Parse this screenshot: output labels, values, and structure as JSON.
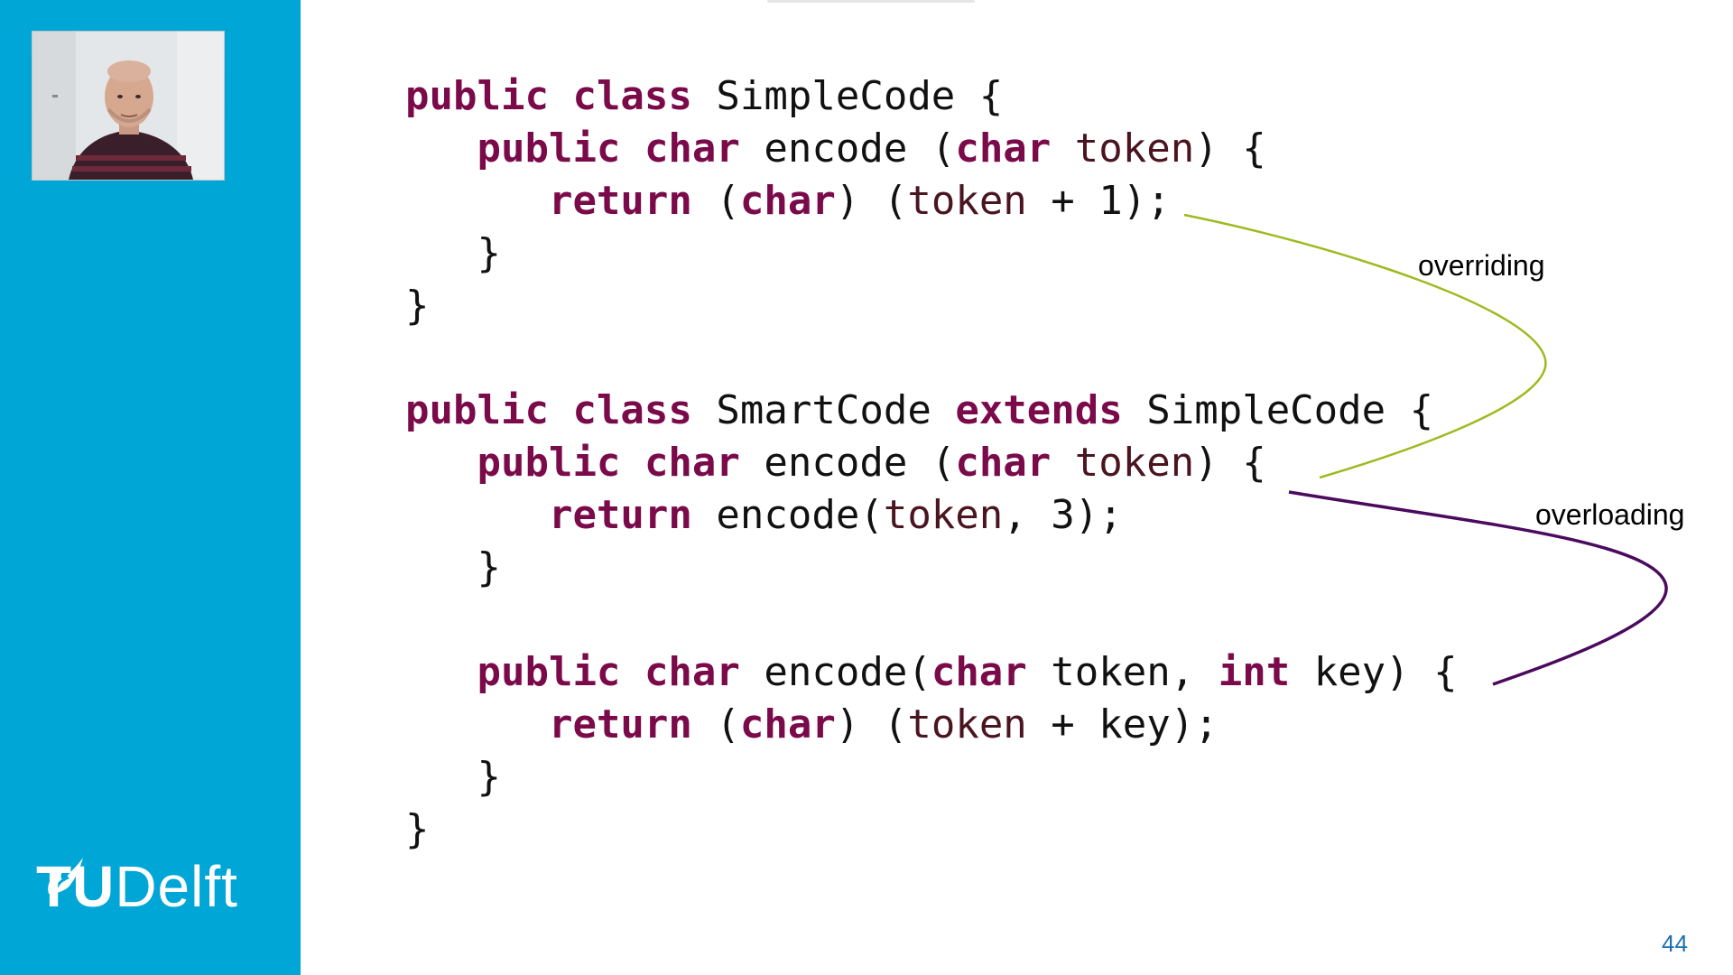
{
  "colors": {
    "sidebar": "#00A6D6",
    "keyword": "#7A0A4A",
    "overriding_arrow": "#9cbb1f",
    "overloading_arrow": "#4b0a5e",
    "slide_number": "#1a6fb0"
  },
  "logo": {
    "tu": "TU",
    "delft": "Delft"
  },
  "webcam": {
    "icon": "presenter-video"
  },
  "code": {
    "lines": [
      [
        {
          "k": "kw",
          "t": "public"
        },
        {
          "k": "pl",
          "t": " "
        },
        {
          "k": "kw",
          "t": "class"
        },
        {
          "k": "pl",
          "t": " SimpleCode {"
        }
      ],
      [
        {
          "k": "pl",
          "t": "   "
        },
        {
          "k": "kw",
          "t": "public"
        },
        {
          "k": "pl",
          "t": " "
        },
        {
          "k": "kw",
          "t": "char"
        },
        {
          "k": "pl",
          "t": " encode ("
        },
        {
          "k": "kw",
          "t": "char"
        },
        {
          "k": "pl",
          "t": " "
        },
        {
          "k": "id",
          "t": "token"
        },
        {
          "k": "pl",
          "t": ") {"
        }
      ],
      [
        {
          "k": "pl",
          "t": "      "
        },
        {
          "k": "kw",
          "t": "return"
        },
        {
          "k": "pl",
          "t": " ("
        },
        {
          "k": "kw",
          "t": "char"
        },
        {
          "k": "pl",
          "t": ") ("
        },
        {
          "k": "id",
          "t": "token"
        },
        {
          "k": "pl",
          "t": " + 1);"
        }
      ],
      [
        {
          "k": "pl",
          "t": "   }"
        }
      ],
      [
        {
          "k": "pl",
          "t": "}"
        }
      ],
      [
        {
          "k": "pl",
          "t": ""
        }
      ],
      [
        {
          "k": "kw",
          "t": "public"
        },
        {
          "k": "pl",
          "t": " "
        },
        {
          "k": "kw",
          "t": "class"
        },
        {
          "k": "pl",
          "t": " SmartCode "
        },
        {
          "k": "kw",
          "t": "extends"
        },
        {
          "k": "pl",
          "t": " SimpleCode {"
        }
      ],
      [
        {
          "k": "pl",
          "t": "   "
        },
        {
          "k": "kw",
          "t": "public"
        },
        {
          "k": "pl",
          "t": " "
        },
        {
          "k": "kw",
          "t": "char"
        },
        {
          "k": "pl",
          "t": " encode ("
        },
        {
          "k": "kw",
          "t": "char"
        },
        {
          "k": "pl",
          "t": " "
        },
        {
          "k": "id",
          "t": "token"
        },
        {
          "k": "pl",
          "t": ") {"
        }
      ],
      [
        {
          "k": "pl",
          "t": "      "
        },
        {
          "k": "kw",
          "t": "return"
        },
        {
          "k": "pl",
          "t": " encode("
        },
        {
          "k": "id",
          "t": "token"
        },
        {
          "k": "pl",
          "t": ", 3);"
        }
      ],
      [
        {
          "k": "pl",
          "t": "   }"
        }
      ],
      [
        {
          "k": "pl",
          "t": ""
        }
      ],
      [
        {
          "k": "pl",
          "t": "   "
        },
        {
          "k": "kw",
          "t": "public"
        },
        {
          "k": "pl",
          "t": " "
        },
        {
          "k": "kw",
          "t": "char"
        },
        {
          "k": "pl",
          "t": " encode("
        },
        {
          "k": "kw",
          "t": "char"
        },
        {
          "k": "pl",
          "t": " token, "
        },
        {
          "k": "kw",
          "t": "int"
        },
        {
          "k": "pl",
          "t": " key) {"
        }
      ],
      [
        {
          "k": "pl",
          "t": "      "
        },
        {
          "k": "kw",
          "t": "return"
        },
        {
          "k": "pl",
          "t": " ("
        },
        {
          "k": "kw",
          "t": "char"
        },
        {
          "k": "pl",
          "t": ") ("
        },
        {
          "k": "id",
          "t": "token"
        },
        {
          "k": "pl",
          "t": " + key);"
        }
      ],
      [
        {
          "k": "pl",
          "t": "   }"
        }
      ],
      [
        {
          "k": "pl",
          "t": "}"
        }
      ]
    ]
  },
  "annotations": {
    "overriding": "overriding",
    "overloading": "overloading"
  },
  "slide_number": "44"
}
